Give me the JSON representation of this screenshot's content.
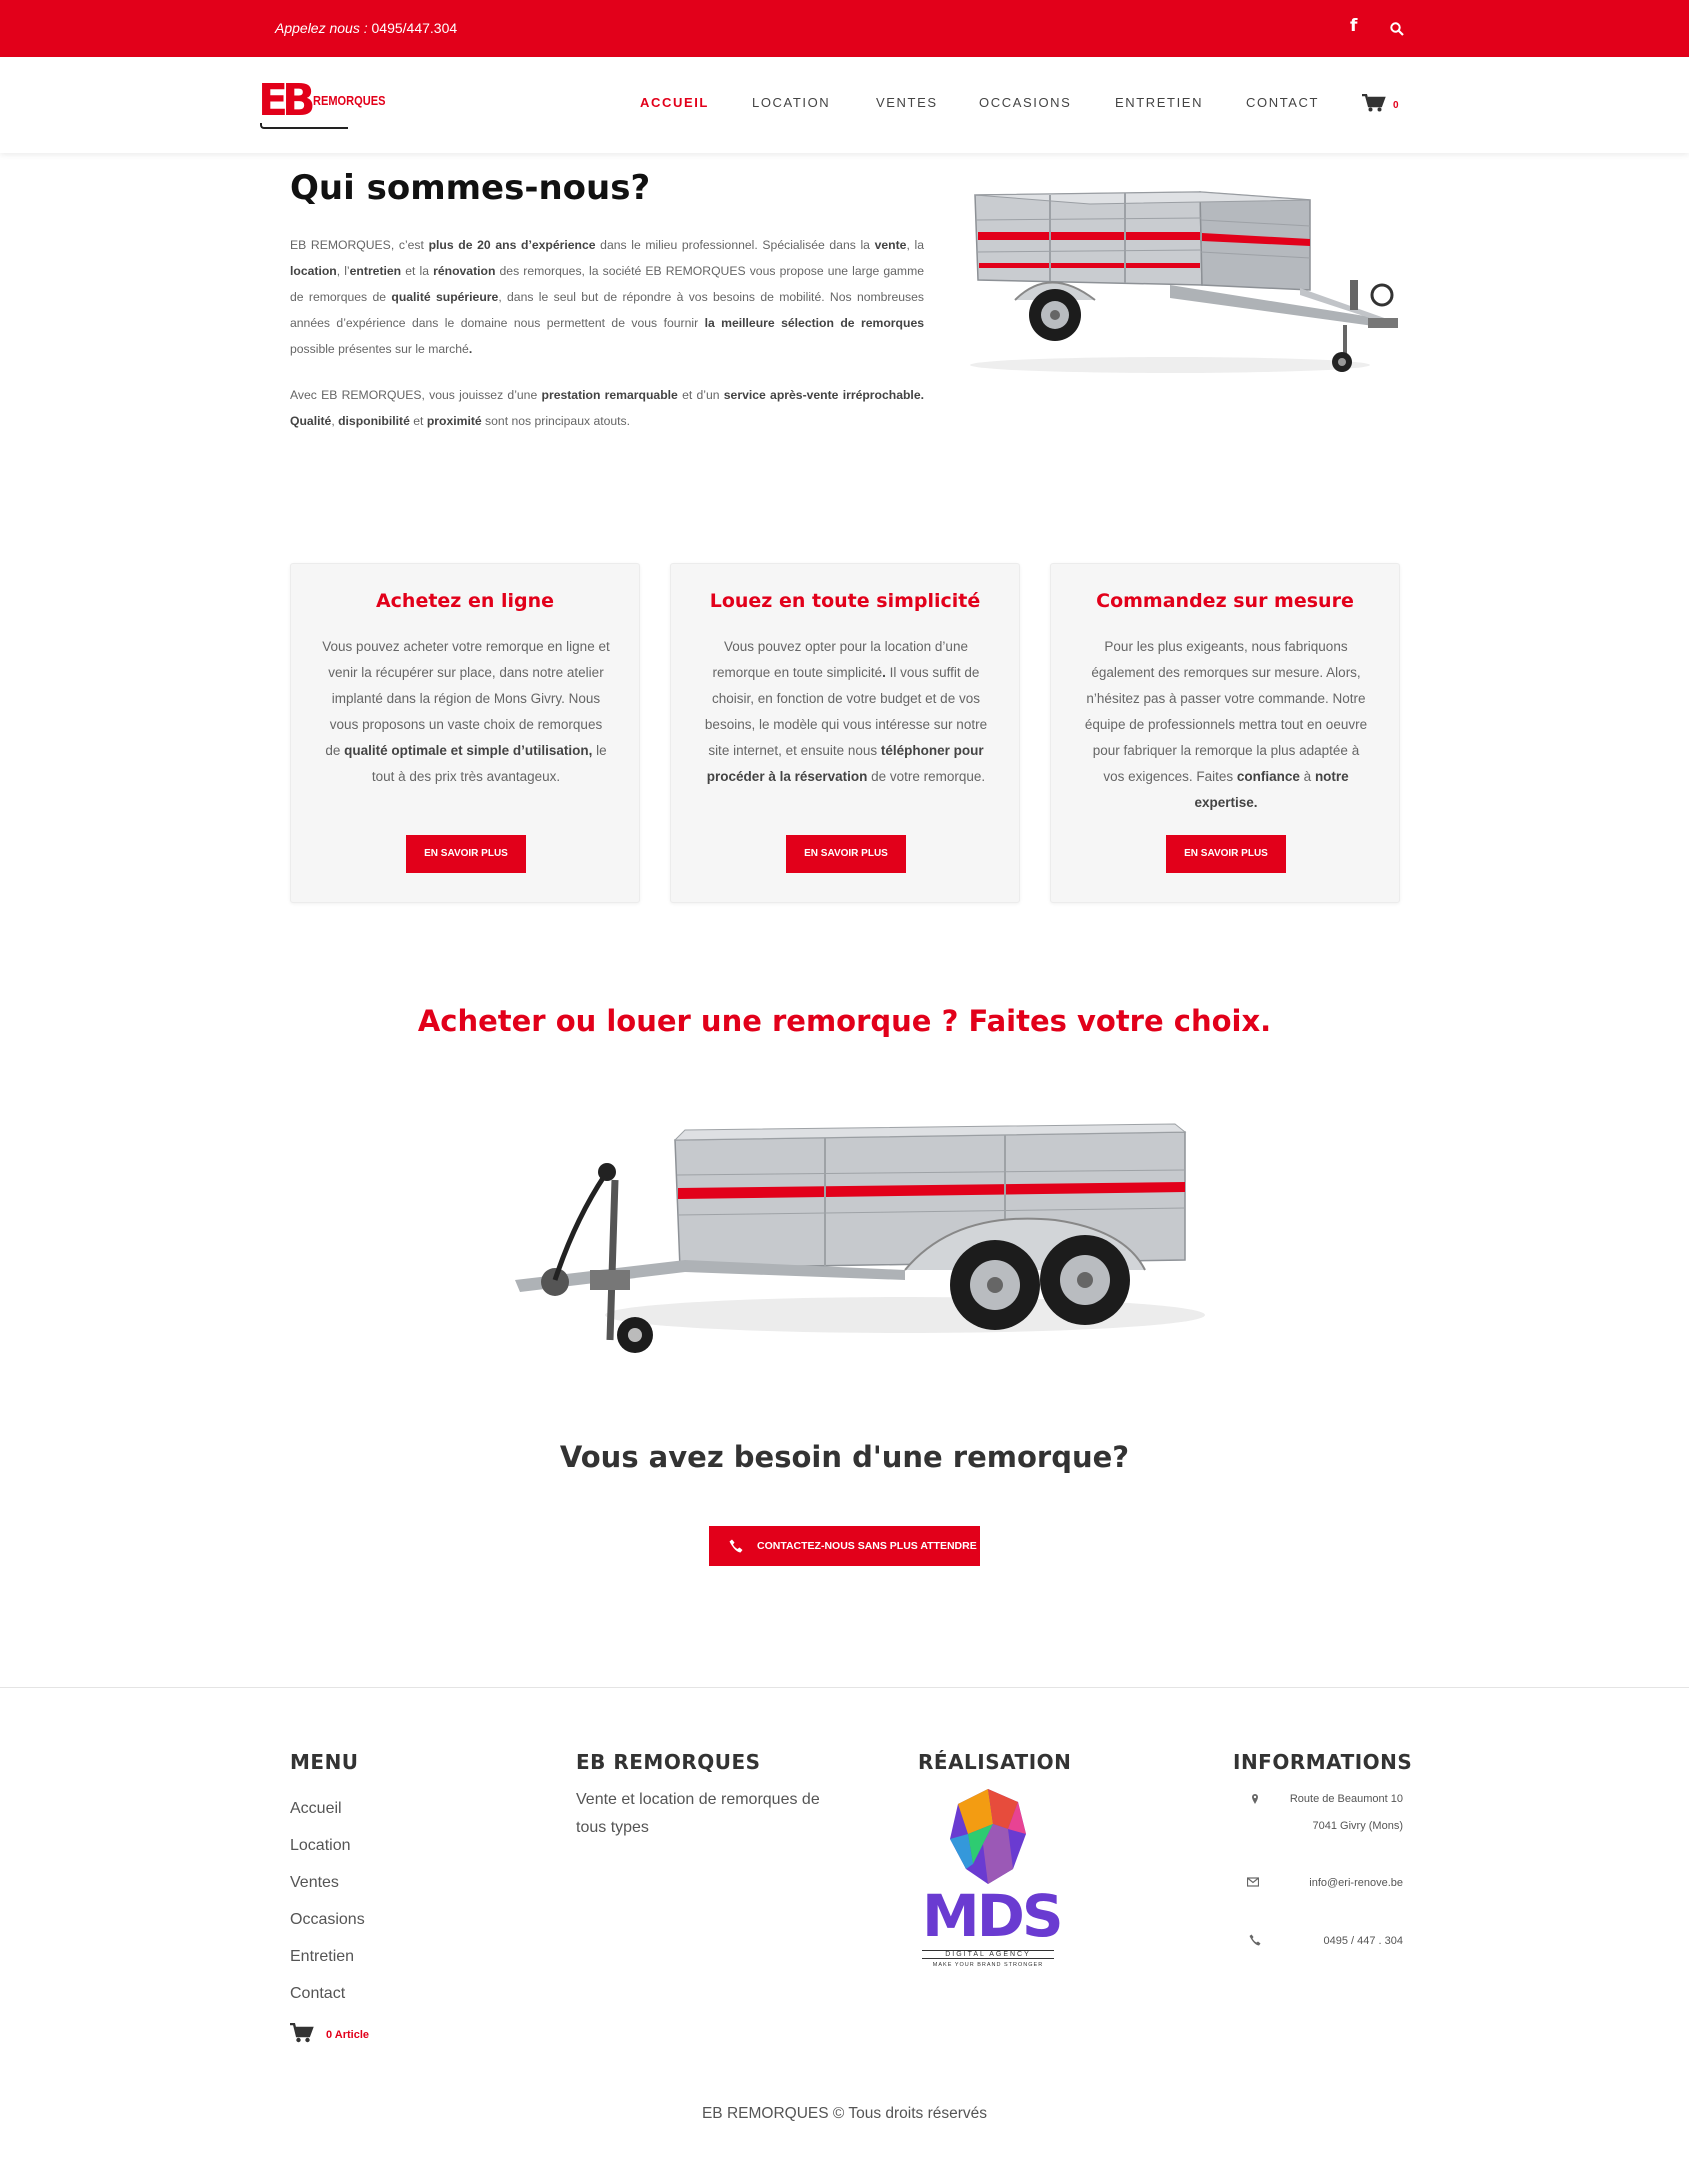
{
  "colors": {
    "brand_red": "#e2001a",
    "text": "#555555",
    "card_bg": "#f6f6f6"
  },
  "topbar": {
    "phone_label": "Appelez nous : ",
    "phone_number": "0495/447.304",
    "facebook_icon": "facebook-icon",
    "search_icon": "search-icon"
  },
  "header": {
    "logo_letters": "EB",
    "logo_word": "REMORQUES",
    "nav": [
      "ACCUEIL",
      "LOCATION",
      "VENTES",
      "OCCASIONS",
      "ENTRETIEN",
      "CONTACT"
    ],
    "active_nav": "ACCUEIL",
    "cart_count": "0"
  },
  "intro": {
    "title": "Qui sommes-nous?",
    "p1": [
      {
        "t": "EB REMORQUES, c’est "
      },
      {
        "t": "plus de 20 ans d’expérience",
        "b": true
      },
      {
        "t": " dans le milieu professionnel. Spécialisée dans la "
      },
      {
        "t": "vente",
        "b": true
      },
      {
        "t": ", la "
      },
      {
        "t": "location",
        "b": true
      },
      {
        "t": ", l’"
      },
      {
        "t": "entretien",
        "b": true
      },
      {
        "t": " et la "
      },
      {
        "t": "rénovation",
        "b": true
      },
      {
        "t": " des remorques, la société EB REMORQUES vous propose une large gamme de remorques de "
      },
      {
        "t": "qualité supérieure",
        "b": true
      },
      {
        "t": ", dans le seul but de répondre à vos besoins de mobilité. Nos nombreuses années d’expérience dans le domaine nous permettent de vous fournir "
      },
      {
        "t": "la meilleure sélection de remorques",
        "b": true
      },
      {
        "t": " possible présentes sur le marché"
      },
      {
        "t": ".",
        "b": true
      }
    ],
    "p2": [
      {
        "t": "Avec EB REMORQUES, vous jouissez d’une "
      },
      {
        "t": "prestation remarquable",
        "b": true
      },
      {
        "t": " et d’un "
      },
      {
        "t": "service après-vente irréprochable. Qualité",
        "b": true
      },
      {
        "t": ", "
      },
      {
        "t": "disponibilité",
        "b": true
      },
      {
        "t": " et "
      },
      {
        "t": "proximité",
        "b": true
      },
      {
        "t": " sont nos principaux atouts."
      }
    ]
  },
  "cards": [
    {
      "title": "Achetez en ligne",
      "body": [
        {
          "t": "Vous pouvez acheter votre remorque en ligne et venir la récupérer sur place, dans notre atelier implanté dans la région de Mons Givry. Nous vous proposons un vaste choix de remorques de "
        },
        {
          "t": "qualité optimale et simple d’utilisation,",
          "b": true
        },
        {
          "t": " le tout à des prix très avantageux."
        }
      ],
      "button": "EN SAVOIR PLUS"
    },
    {
      "title": "Louez en toute simplicité",
      "body": [
        {
          "t": "Vous pouvez opter pour la location d’une remorque en toute simplicité"
        },
        {
          "t": ".",
          "b": true
        },
        {
          "t": " Il vous suffit de choisir, en fonction de votre budget et de vos besoins, le modèle qui vous intéresse sur notre site internet, et ensuite nous "
        },
        {
          "t": "téléphoner pour procéder à la réservation",
          "b": true
        },
        {
          "t": " de votre remorque."
        }
      ],
      "button": "EN SAVOIR PLUS"
    },
    {
      "title": "Commandez sur mesure",
      "body": [
        {
          "t": "Pour les plus exigeants, nous fabriquons également des remorques sur mesure. Alors, n’hésitez pas à passer votre commande. Notre équipe de professionnels mettra tout en oeuvre pour fabriquer la remorque la plus adaptée à vos exigences. Faites "
        },
        {
          "t": "confiance",
          "b": true
        },
        {
          "t": " à "
        },
        {
          "t": "notre expertise.",
          "b": true
        }
      ],
      "button": "EN SAVOIR PLUS"
    }
  ],
  "choice": {
    "title": "Acheter ou louer une remorque ? Faites votre choix."
  },
  "need": {
    "title": "Vous avez besoin d'une remorque?",
    "cta": "CONTACTEZ-NOUS SANS PLUS ATTENDRE"
  },
  "footer": {
    "menu_title": "MENU",
    "menu_items": [
      "Accueil",
      "Location",
      "Ventes",
      "Occasions",
      "Entretien",
      "Contact"
    ],
    "cart_label": "0 Article",
    "about_title": "EB REMORQUES",
    "about_text": "Vente et location de remorques de tous types",
    "realisation_title": "RÉALISATION",
    "mds_letters": "MDS",
    "mds_tag": "DIGITAL AGENCY",
    "mds_slogan": "MAKE YOUR BRAND STRONGER",
    "info_title": "INFORMATIONS",
    "address_line1": "Route de Beaumont 10",
    "address_line2": "7041 Givry (Mons)",
    "email": "info@eri-renove.be",
    "phone": "0495 / 447 . 304",
    "copyright": "EB REMORQUES © Tous droits réservés"
  }
}
